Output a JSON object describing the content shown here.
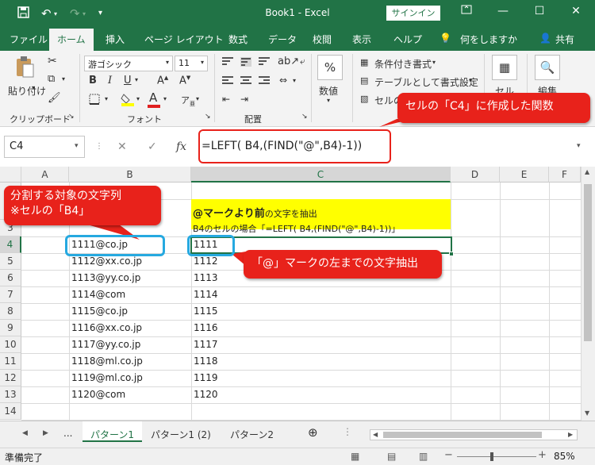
{
  "window": {
    "title": "Book1 - Excel",
    "signin_label": "サインイン"
  },
  "menu": {
    "tabs": [
      "ファイル",
      "ホーム",
      "挿入",
      "ページ レイアウト",
      "数式",
      "データ",
      "校閲",
      "表示",
      "ヘルプ",
      "何をしますか",
      "共有"
    ]
  },
  "ribbon": {
    "paste_label": "貼り付け",
    "clipboard_label": "クリップボード",
    "font_name": "游ゴシック",
    "font_size": "11",
    "font_group_label": "フォント",
    "align_group_label": "配置",
    "number_label": "数値",
    "number_icon": "%",
    "cond_format_label": "条件付き書式",
    "table_format_label": "テーブルとして書式設定",
    "cell_style_label": "セルの",
    "cell_label": "セル",
    "edit_label": "編集"
  },
  "formula_bar": {
    "name_box": "C4",
    "formula": "=LEFT( B4,(FIND(\"@\",B4)-1))"
  },
  "grid": {
    "columns": [
      "A",
      "B",
      "C",
      "D",
      "E",
      "F"
    ],
    "rows": [
      "3",
      "4",
      "5",
      "6",
      "7",
      "8",
      "9",
      "10",
      "11",
      "12",
      "13",
      "14"
    ],
    "header_main": "@マークより前",
    "header_sub": "の文字を抽出",
    "note": "B4のセルの場合「=LEFT( B4,(FIND(\"@\",B4)-1))」",
    "data_b": [
      "1111@co.jp",
      "1112@xx.co.jp",
      "1113@yy.co.jp",
      "1114@com",
      "1115@co.jp",
      "1116@xx.co.jp",
      "1117@yy.co.jp",
      "1118@ml.co.jp",
      "1119@ml.co.jp",
      "1120@com"
    ],
    "data_c": [
      "1111",
      "1112",
      "1113",
      "1114",
      "1115",
      "1116",
      "1117",
      "1118",
      "1119",
      "1120"
    ]
  },
  "sheets": {
    "more": "...",
    "tabs": [
      "パターン1",
      "パターン1 (2)",
      "パターン2"
    ]
  },
  "status": {
    "ready": "準備完了",
    "zoom": "85%"
  },
  "annotations": {
    "formula_callout": "セルの「C4」に作成した関数",
    "source_callout_line1": "分割する対象の文字列",
    "source_callout_line2": "※セルの「B4」",
    "result_callout": "「@」マークの左までの文字抽出"
  },
  "colors": {
    "excel_green": "#217346",
    "callout_red": "#e8221b",
    "highlight_blue": "#26a9e0",
    "cell_yellow": "#ffff00"
  }
}
